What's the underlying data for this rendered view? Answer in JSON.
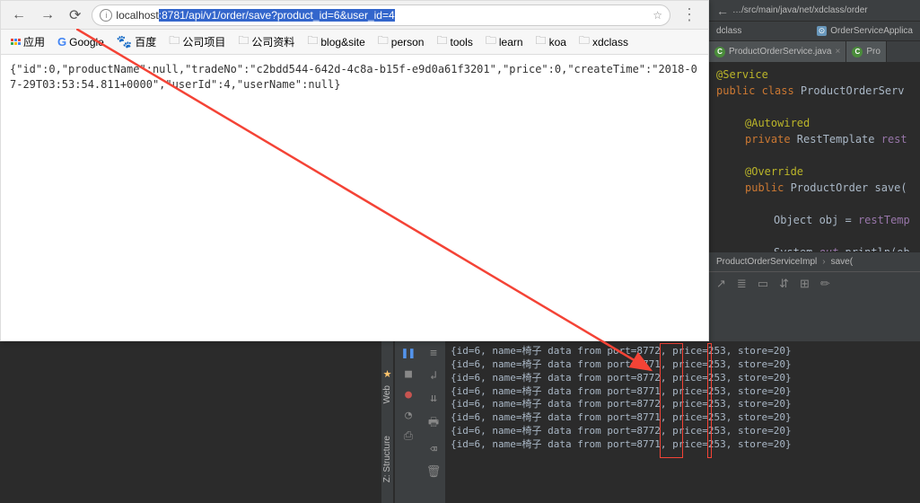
{
  "browser": {
    "url_prefix": "localhost",
    "url_highlighted": ":8781/api/v1/order/save?product_id=6&user_id=4",
    "bookmarks": [
      {
        "icon": "apps",
        "label": "应用"
      },
      {
        "icon": "google",
        "label": "Google"
      },
      {
        "icon": "baidu",
        "label": "百度"
      },
      {
        "icon": "folder",
        "label": "公司项目"
      },
      {
        "icon": "folder",
        "label": "公司资料"
      },
      {
        "icon": "folder",
        "label": "blog&site"
      },
      {
        "icon": "folder",
        "label": "person"
      },
      {
        "icon": "folder",
        "label": "tools"
      },
      {
        "icon": "folder",
        "label": "learn"
      },
      {
        "icon": "folder",
        "label": "koa"
      },
      {
        "icon": "folder",
        "label": "xdclass"
      }
    ],
    "content": "{\"id\":0,\"productName\":null,\"tradeNo\":\"c2bdd544-642d-4c8a-b15f-e9d0a61f3201\",\"price\":0,\"createTime\":\"2018-07-29T03:53:54.811+0000\",\"userId\":4,\"userName\":null}"
  },
  "ide": {
    "path": "…/src/main/java/net/xdclass/order",
    "path_tail": "dclass",
    "run_config": "OrderServiceApplica",
    "tabs": [
      {
        "label": "ProductOrderService.java",
        "active": true
      },
      {
        "label": "Pro",
        "active": false
      }
    ],
    "code": {
      "l0": "@Service",
      "l1_kw": "public class",
      "l1_name": " ProductOrderServ",
      "l2": "@Autowired",
      "l3_kw": "private",
      "l3_type": " RestTemplate",
      "l3_var": " rest",
      "l4": "@Override",
      "l5_kw": "public",
      "l5_type": " ProductOrder",
      "l5_name": " save(",
      "l6_a": "Object ",
      "l6_b": "obj",
      "l6_c": " = ",
      "l6_d": "restTemp",
      "l7_a": "System.",
      "l7_b": "out",
      "l7_c": ".println(ob"
    },
    "breadcrumb": {
      "a": "ProductOrderServiceImpl",
      "b": "save("
    }
  },
  "console": {
    "lines": [
      "{id=6, name=椅子 data from port=8772, price=253, store=20}",
      "{id=6, name=椅子 data from port=8771, price=253, store=20}",
      "{id=6, name=椅子 data from port=8772, price=253, store=20}",
      "{id=6, name=椅子 data from port=8771, price=253, store=20}",
      "{id=6, name=椅子 data from port=8772, price=253, store=20}",
      "{id=6, name=椅子 data from port=8771, price=253, store=20}",
      "{id=6, name=椅子 data from port=8772, price=253, store=20}",
      "{id=6, name=椅子 data from port=8771, price=253, store=20}"
    ]
  },
  "side_labels": {
    "web": "Web",
    "structure": "Z: Structure"
  }
}
